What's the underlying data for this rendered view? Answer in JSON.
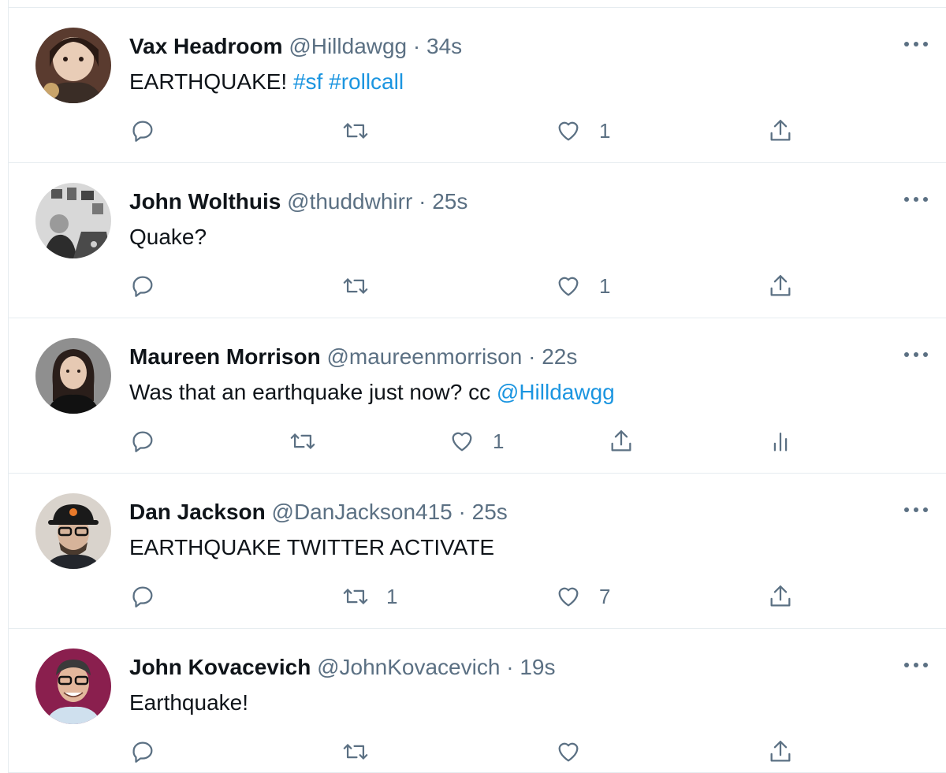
{
  "tweets": [
    {
      "name": "Vax Headroom",
      "handle": "@Hilldawgg",
      "separator": "·",
      "time": "34s",
      "text": "EARTHQUAKE! ",
      "links": [
        "#sf",
        " #rollcall"
      ],
      "retweets": "",
      "likes": "1",
      "avatar_color": "#6b4a3c"
    },
    {
      "name": "John Wolthuis",
      "handle": "@thuddwhirr",
      "separator": "·",
      "time": "25s",
      "text": "Quake?",
      "retweets": "",
      "likes": "1",
      "avatar_color": "#3a3a3a"
    },
    {
      "name": "Maureen Morrison",
      "handle": "@maureenmorrison",
      "separator": "·",
      "time": "22s",
      "text": "Was that an earthquake just now? cc ",
      "mention": "@Hilldawgg",
      "retweets": "",
      "likes": "1",
      "avatar_color": "#8a8a8a"
    },
    {
      "name": "Dan Jackson",
      "handle": "@DanJackson415",
      "separator": "·",
      "time": "25s",
      "text": "EARTHQUAKE TWITTER ACTIVATE",
      "retweets": "1",
      "likes": "7",
      "avatar_color": "#c8c2ba"
    },
    {
      "name": "John Kovacevich",
      "handle": "@JohnKovacevich",
      "separator": "·",
      "time": "19s",
      "text": "Earthquake!",
      "retweets": "",
      "likes": "",
      "avatar_color": "#8a1f4e"
    }
  ],
  "icons": {
    "reply": "reply-icon",
    "retweet": "retweet-icon",
    "like": "heart-icon",
    "share": "share-icon",
    "analytics": "analytics-icon",
    "more": "more-icon"
  },
  "colors": {
    "link": "#1b95e0",
    "secondary_text": "#5b7083",
    "divider": "#e6ecf0"
  }
}
